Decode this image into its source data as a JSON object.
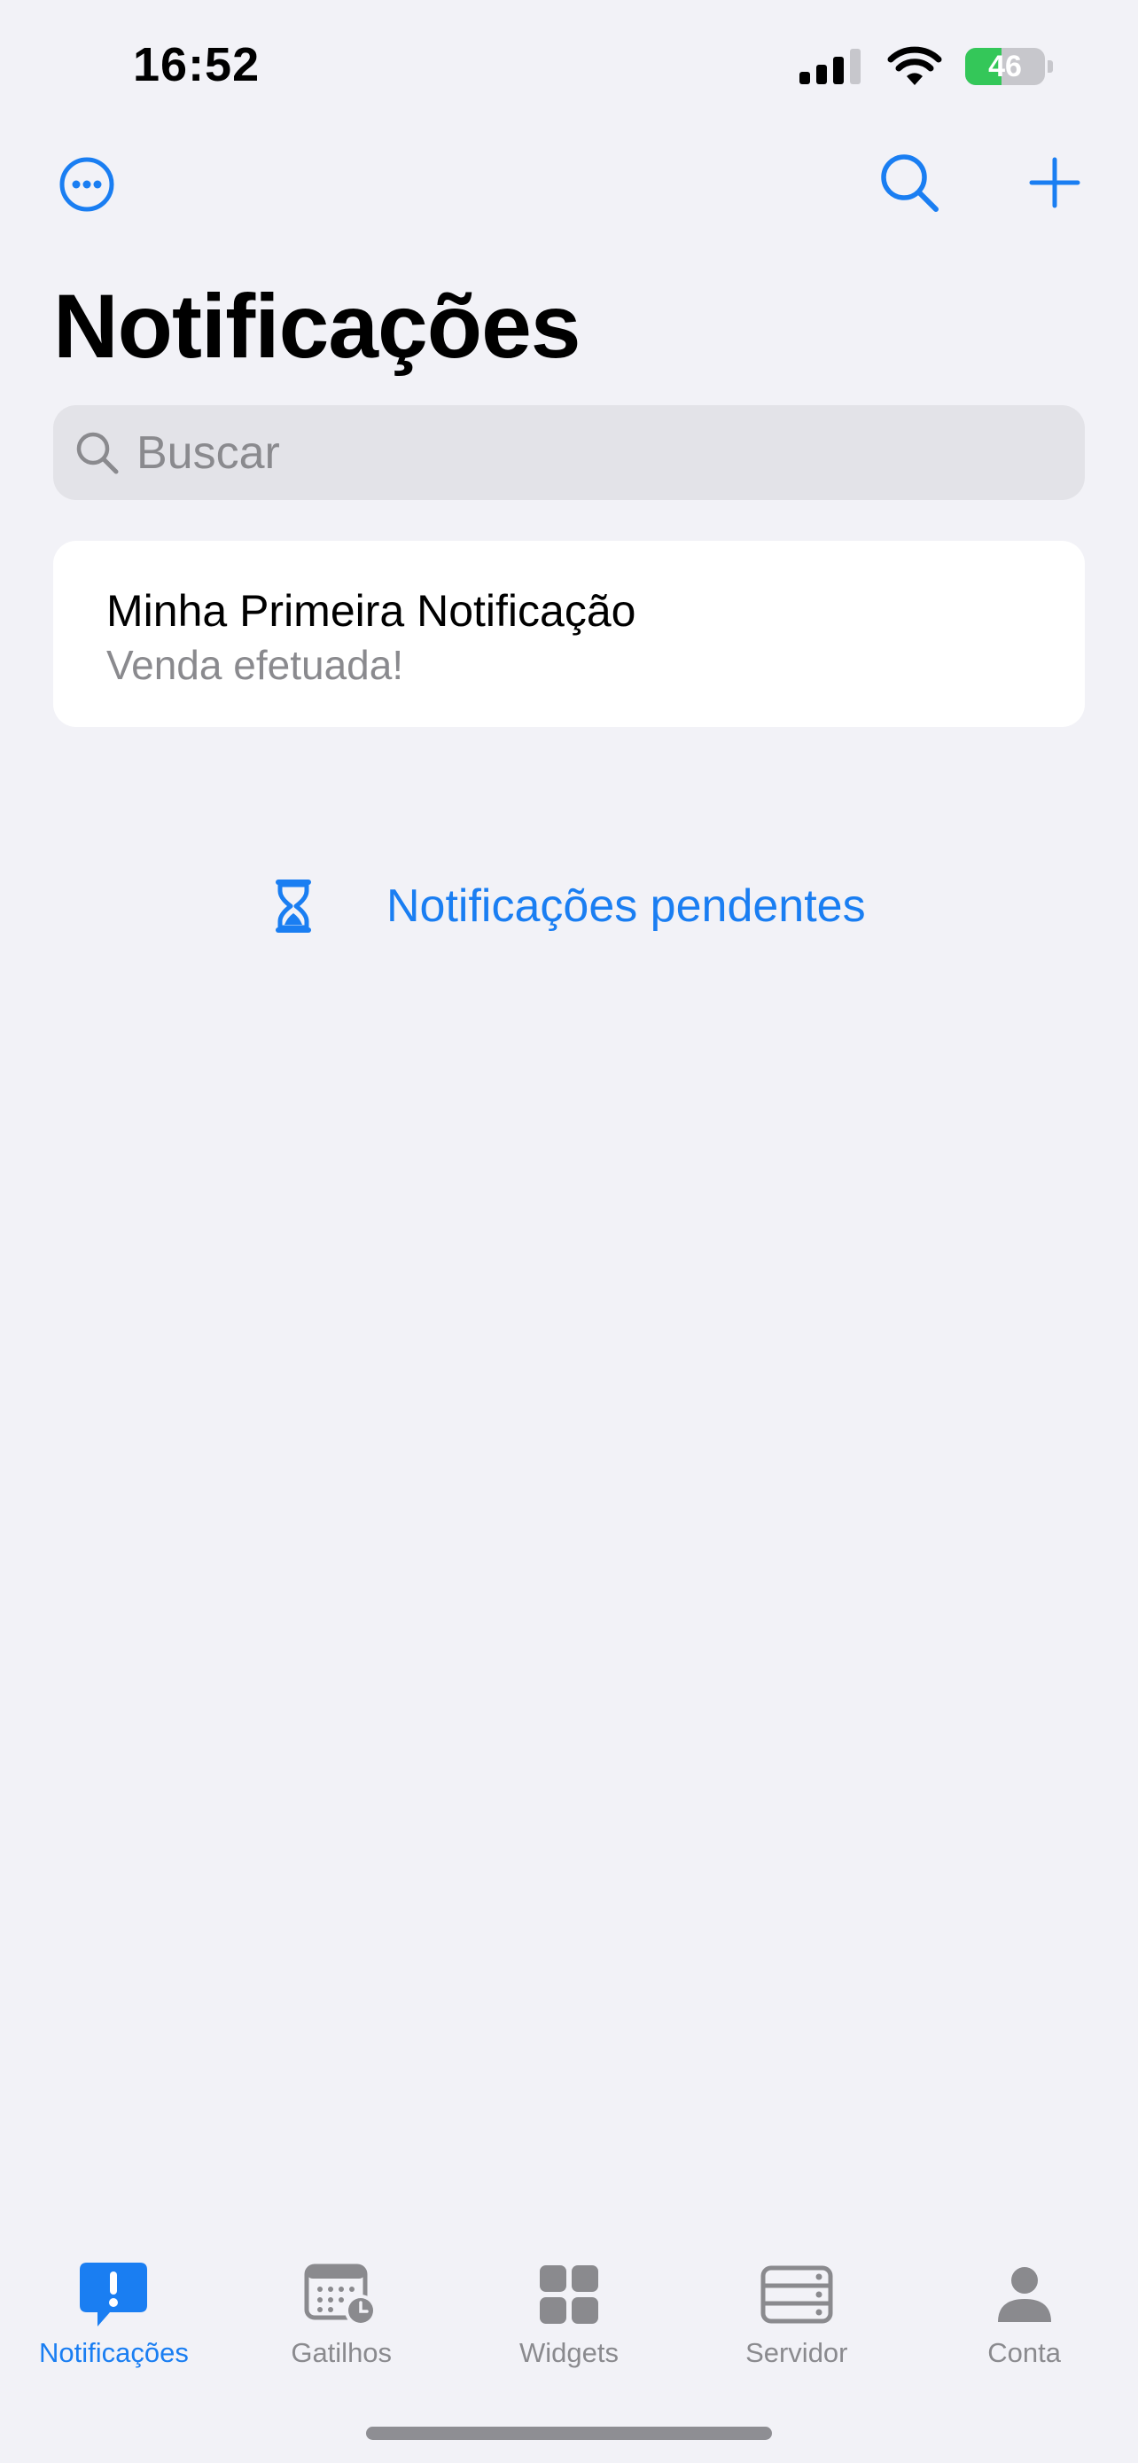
{
  "status_bar": {
    "time": "16:52",
    "battery_percent": "46",
    "battery_level": 0.46,
    "signal_bars": 3
  },
  "nav": {
    "title": "Notificações"
  },
  "search": {
    "placeholder": "Buscar"
  },
  "notifications": [
    {
      "title": "Minha Primeira Notificação",
      "subtitle": "Venda efetuada!"
    }
  ],
  "pending": {
    "label": "Notificações pendentes"
  },
  "tabs": [
    {
      "label": "Notificações",
      "icon": "exclamation-bubble-icon",
      "active": true
    },
    {
      "label": "Gatilhos",
      "icon": "calendar-clock-icon",
      "active": false
    },
    {
      "label": "Widgets",
      "icon": "grid-icon",
      "active": false
    },
    {
      "label": "Servidor",
      "icon": "server-rack-icon",
      "active": false
    },
    {
      "label": "Conta",
      "icon": "person-icon",
      "active": false
    }
  ],
  "colors": {
    "accent": "#1a7ef2",
    "background": "#f2f2f7",
    "secondary_text": "#8a8a8e",
    "battery_fill": "#34c759"
  }
}
